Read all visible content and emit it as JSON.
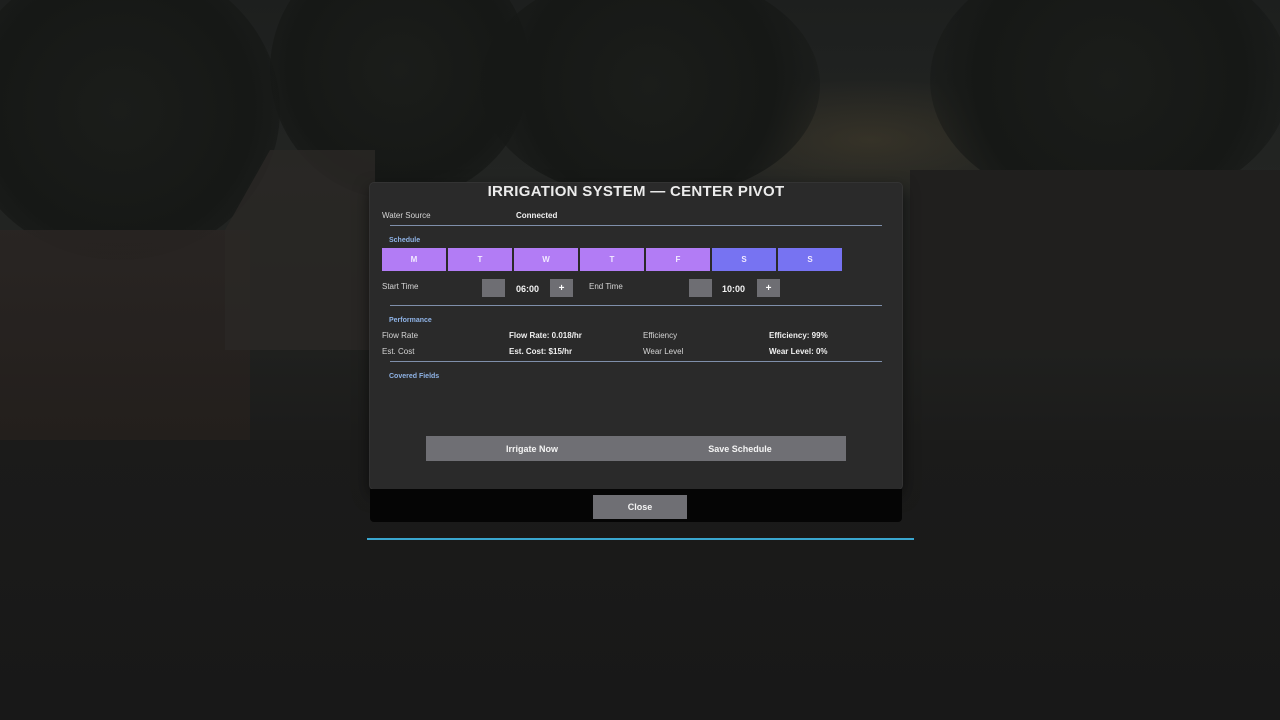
{
  "dialog": {
    "title": "IRRIGATION SYSTEM — CENTER PIVOT",
    "water_source": {
      "label": "Water Source",
      "value": "Connected"
    },
    "schedule": {
      "section_label": "Schedule",
      "days": [
        {
          "label": "M",
          "type": "weekday"
        },
        {
          "label": "T",
          "type": "weekday"
        },
        {
          "label": "W",
          "type": "weekday"
        },
        {
          "label": "T",
          "type": "weekday"
        },
        {
          "label": "F",
          "type": "weekday"
        },
        {
          "label": "S",
          "type": "weekend"
        },
        {
          "label": "S",
          "type": "weekend"
        }
      ],
      "start_time": {
        "label": "Start Time",
        "value": "06:00",
        "increment": "+"
      },
      "end_time": {
        "label": "End Time",
        "value": "10:00",
        "increment": "+"
      }
    },
    "performance": {
      "section_label": "Performance",
      "flow_rate": {
        "label": "Flow Rate",
        "value": "Flow Rate: 0.018/hr"
      },
      "efficiency": {
        "label": "Efficiency",
        "value": "Efficiency: 99%"
      },
      "est_cost": {
        "label": "Est. Cost",
        "value": "Est. Cost: $15/hr"
      },
      "wear_level": {
        "label": "Wear Level",
        "value": "Wear Level: 0%"
      }
    },
    "covered_fields": {
      "section_label": "Covered Fields"
    },
    "actions": {
      "irrigate_now": "Irrigate Now",
      "save_schedule": "Save Schedule"
    },
    "close_label": "Close"
  },
  "colors": {
    "weekday_button": "#b27cf5",
    "weekend_button": "#7773f2",
    "section_label": "#8fb3e6",
    "accent_line": "#3aa6cf",
    "button_gray": "#6f6f74"
  }
}
